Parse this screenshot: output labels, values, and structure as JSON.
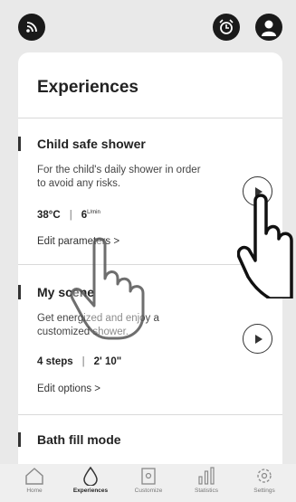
{
  "page_title": "Experiences",
  "sections": [
    {
      "title": "Child safe shower",
      "description": "For the child's daily shower in order to avoid any risks.",
      "meta_a": "38°C",
      "meta_b": "6",
      "meta_b_unit": "L/min",
      "link": "Edit parameters  >"
    },
    {
      "title": "My scene",
      "description": "Get energized and enjoy a customized shower.",
      "meta_a": "4 steps",
      "meta_b": "2' 10\"",
      "link": "Edit options  >"
    },
    {
      "title": "Bath fill mode"
    }
  ],
  "tabs": [
    {
      "label": "Home",
      "icon": "home-icon"
    },
    {
      "label": "Experiences",
      "icon": "drop-icon",
      "active": true
    },
    {
      "label": "Customize",
      "icon": "customize-icon"
    },
    {
      "label": "Statistics",
      "icon": "statistics-icon"
    },
    {
      "label": "Settings",
      "icon": "settings-icon"
    }
  ]
}
